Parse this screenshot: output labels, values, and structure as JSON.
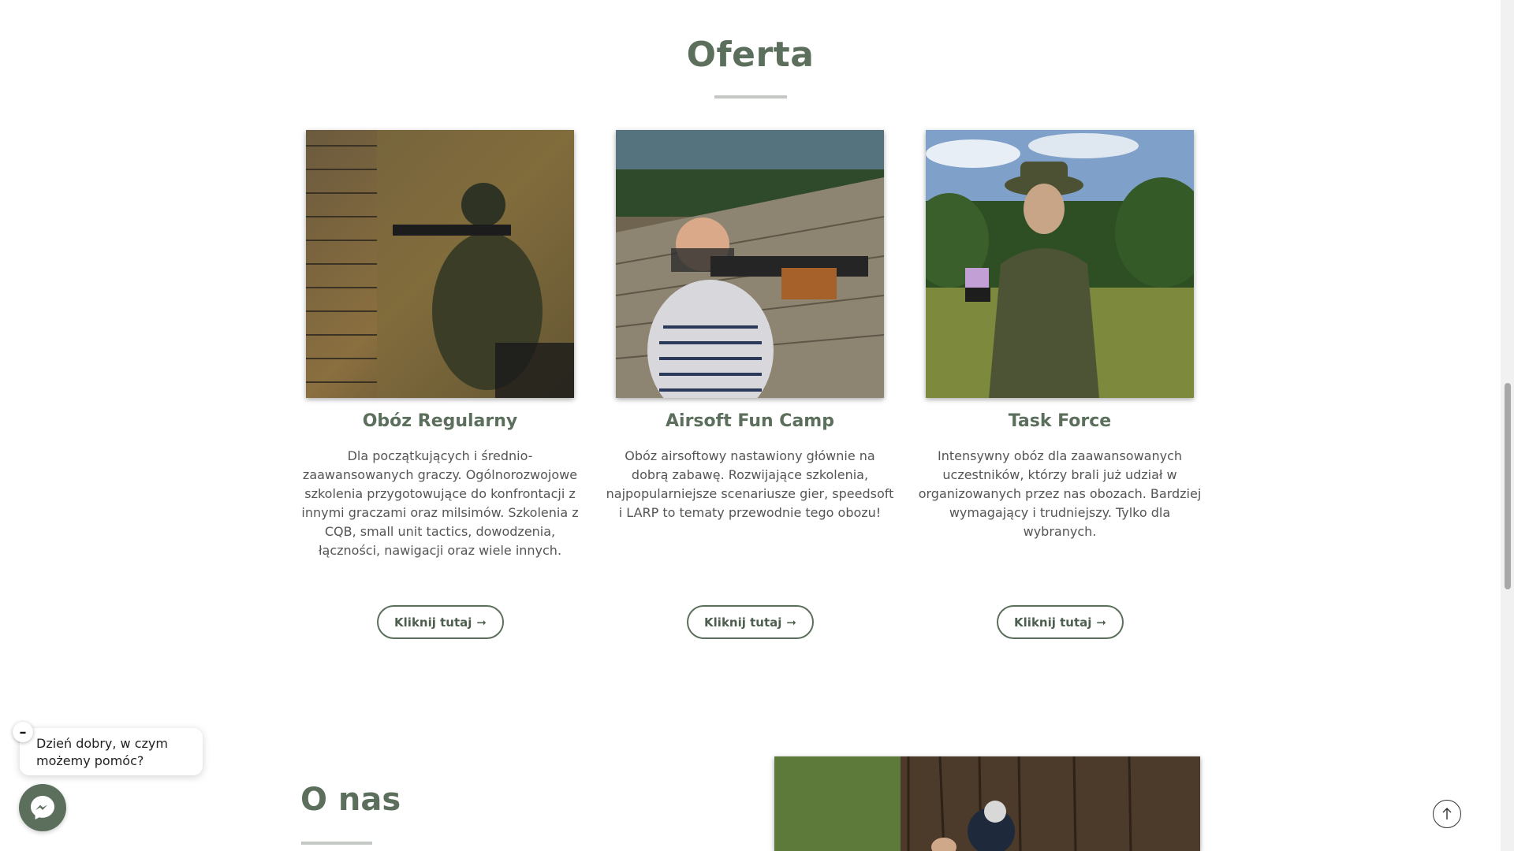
{
  "offer": {
    "title": "Oferta",
    "cards": [
      {
        "title": "Obóz Regularny",
        "description": "Dla początkujących i średnio-zaawansowanych graczy. Ogólnorozwojowe szkolenia przygotowujące do konfrontacji z innymi graczami oraz milsimów. Szkolenia z CQB, small unit tactics, dowodzenia, łączności, nawigacji oraz wiele innych.",
        "button": "Kliknij tutaj"
      },
      {
        "title": "Airsoft Fun Camp",
        "description": "Obóz airsoftowy nastawiony głównie na dobrą zabawę. Rozwijające szkolenia, najpopularniejsze scenariusze gier, speedsoft i LARP to tematy przewodnie tego obozu!",
        "button": "Kliknij tutaj"
      },
      {
        "title": "Task Force",
        "description": "Intensywny obóz dla zaawansowanych uczestników, którzy brali już udział w organizowanych przez nas obozach. Bardziej wymagający i trudniejszy. Tylko dla wybranych.",
        "button": "Kliknij tutaj"
      }
    ],
    "arrow": "➞"
  },
  "about": {
    "title": "O nas"
  },
  "chat": {
    "greeting": "Dzień dobry, w czym możemy pomóc?",
    "close_symbol": "–"
  },
  "icons": {
    "messenger": "messenger-icon",
    "back_to_top": "arrow-up-icon"
  },
  "colors": {
    "accent": "#5b6f5c",
    "rule": "#c4c8c4"
  }
}
